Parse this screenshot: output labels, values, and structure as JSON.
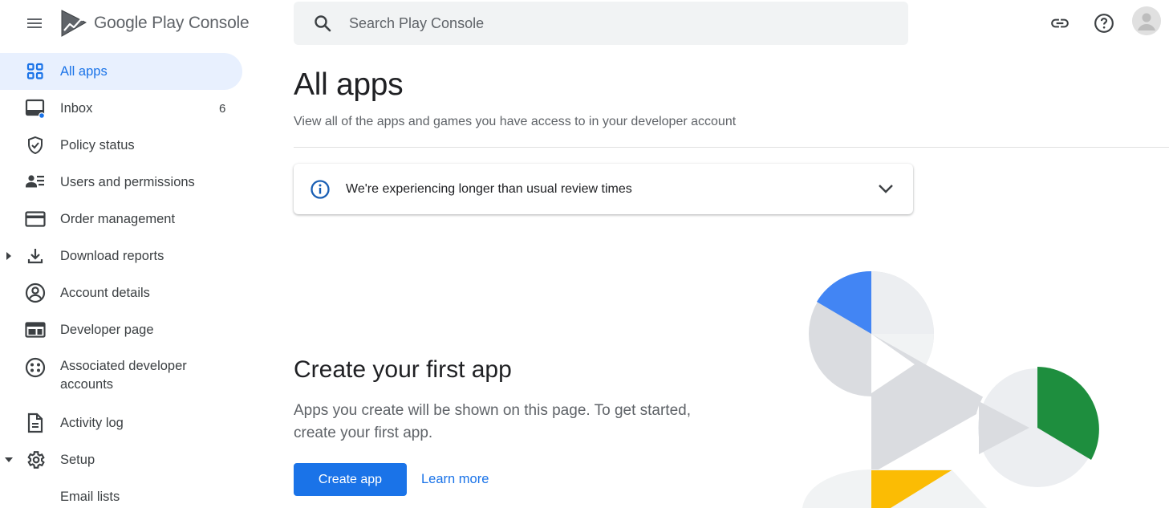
{
  "header": {
    "logo_text_google": "Google Play",
    "logo_text_console": "Console",
    "search_placeholder": "Search Play Console",
    "link_icon": "link-icon",
    "help_icon": "help-icon",
    "avatar_icon": "account-avatar-icon"
  },
  "sidebar": {
    "items": [
      {
        "label": "All apps",
        "icon": "apps-grid-icon",
        "active": true
      },
      {
        "label": "Inbox",
        "icon": "inbox-icon",
        "count": "6"
      },
      {
        "label": "Policy status",
        "icon": "shield-icon"
      },
      {
        "label": "Users and permissions",
        "icon": "users-icon"
      },
      {
        "label": "Order management",
        "icon": "credit-card-icon"
      },
      {
        "label": "Download reports",
        "icon": "download-icon",
        "expandable": true
      },
      {
        "label": "Account details",
        "icon": "account-circle-icon"
      },
      {
        "label": "Developer page",
        "icon": "web-page-icon"
      },
      {
        "label": "Associated developer accounts",
        "label_line1": "Associated developer",
        "label_line2": "accounts",
        "icon": "associated-accounts-icon"
      },
      {
        "label": "Activity log",
        "icon": "document-icon"
      },
      {
        "label": "Setup",
        "icon": "gear-icon",
        "expanded": true
      },
      {
        "label": "Email lists",
        "sub": true
      }
    ]
  },
  "main": {
    "title": "All apps",
    "subtitle": "View all of the apps and games you have access to in your developer account",
    "notice": {
      "text": "We're experiencing longer than usual review times",
      "icon": "info-icon",
      "chevron": "chevron-down-icon"
    },
    "empty_state": {
      "title": "Create your first app",
      "description": "Apps you create will be shown on this page. To get started, create your first app.",
      "primary_button": "Create app",
      "secondary_link": "Learn more"
    }
  },
  "colors": {
    "accent": "#1a73e8",
    "active_bg": "#e8f0fe",
    "illustration_blue": "#4285f4",
    "illustration_green": "#1e8e3e",
    "illustration_yellow": "#fbbc04",
    "illustration_gray": "#dadce0"
  }
}
